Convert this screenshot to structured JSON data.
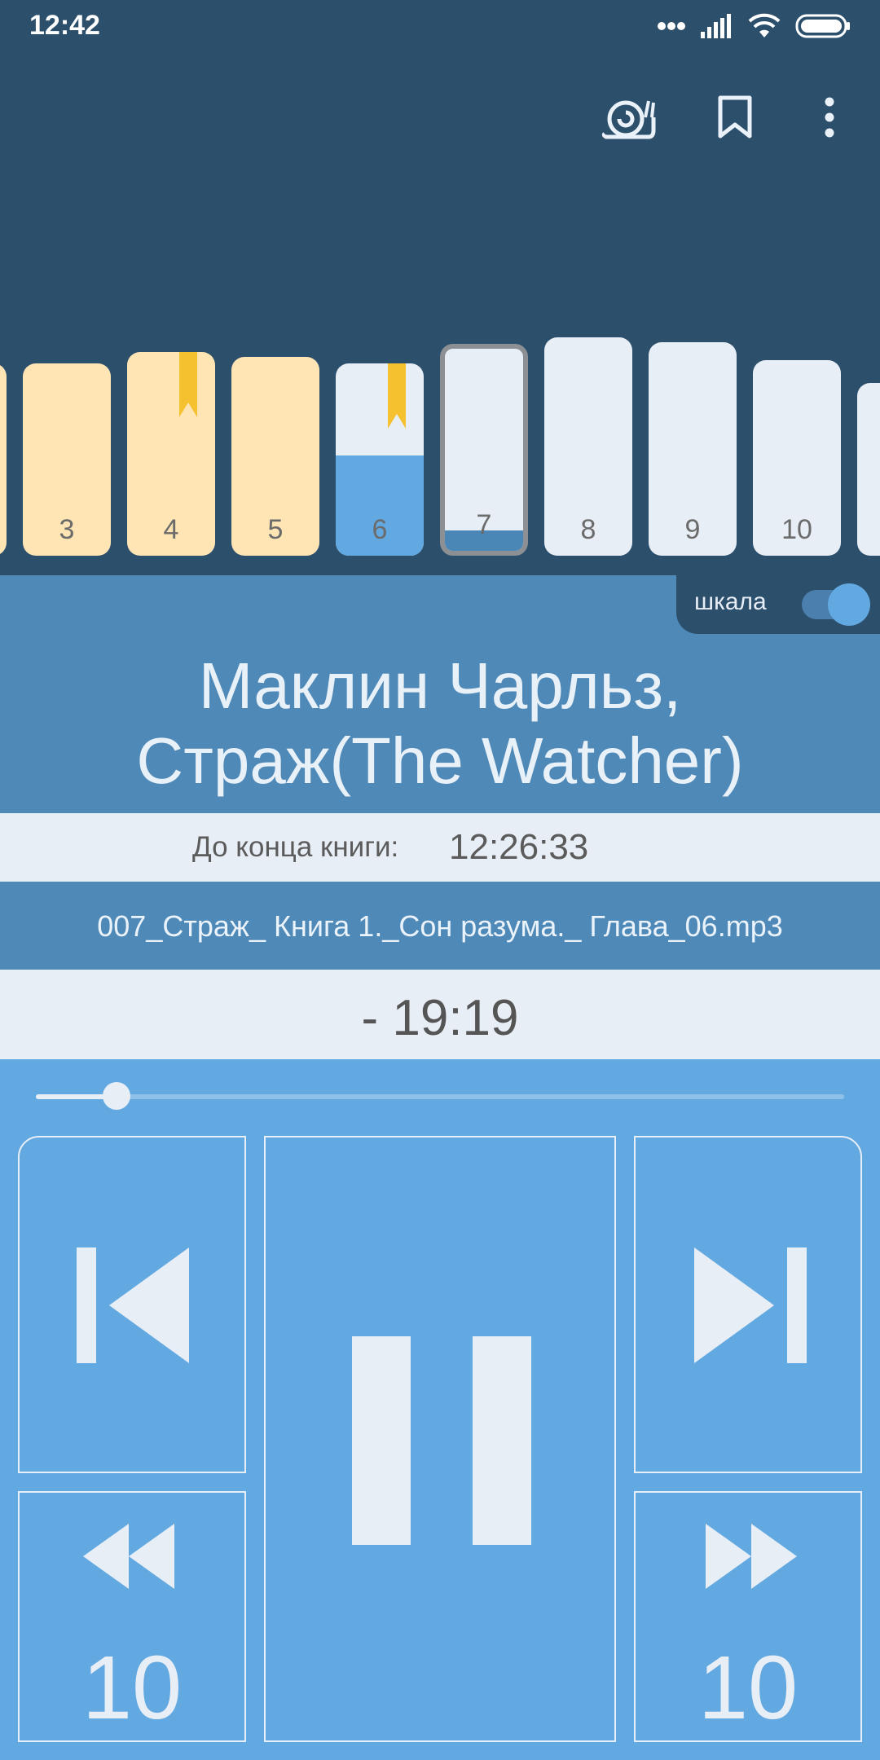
{
  "status_bar": {
    "time": "12:42"
  },
  "toolbar": {
    "icons": [
      "snail-speed-icon",
      "bookmark-icon",
      "more-vert-icon"
    ]
  },
  "chapters": [
    {
      "number": "3",
      "state": "listened",
      "bookmark": false,
      "progress": 1.0
    },
    {
      "number": "4",
      "state": "listened",
      "bookmark": true,
      "progress": 1.0
    },
    {
      "number": "5",
      "state": "listened",
      "bookmark": false,
      "progress": 1.0
    },
    {
      "number": "6",
      "state": "partial",
      "bookmark": true,
      "progress": 0.52
    },
    {
      "number": "7",
      "state": "current",
      "bookmark": false,
      "progress": 0.1
    },
    {
      "number": "8",
      "state": "unplayed",
      "bookmark": false,
      "progress": 0
    },
    {
      "number": "9",
      "state": "unplayed",
      "bookmark": false,
      "progress": 0
    },
    {
      "number": "10",
      "state": "unplayed",
      "bookmark": false,
      "progress": 0
    }
  ],
  "scale_toggle": {
    "label": "шкала",
    "on": true
  },
  "book": {
    "title_line1": "Маклин Чарльз,",
    "title_line2": "Страж(The Watcher)"
  },
  "remaining": {
    "label": "До конца книги:",
    "value": "12:26:33"
  },
  "file": {
    "name": "007_Страж_ Книга 1._Сон разума._ Глава_06.mp3"
  },
  "timer": {
    "value": "- 19:19"
  },
  "seek": {
    "progress": 0.1
  },
  "controls": {
    "rewind_seconds": "10",
    "forward_seconds": "10"
  },
  "colors": {
    "header": "#2C4F6C",
    "accent": "#63A9E1",
    "listened": "#FFE5B4",
    "bookmark": "#F6C12F",
    "light": "#E8EEF6"
  }
}
